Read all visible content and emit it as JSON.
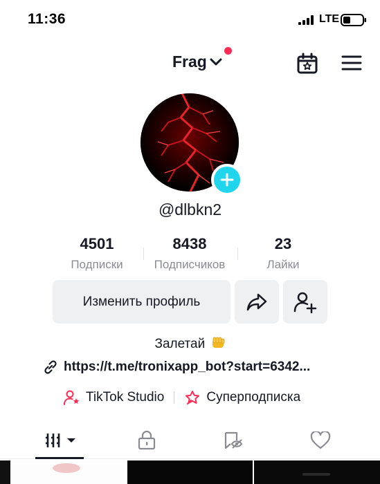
{
  "status_bar": {
    "time": "11:36",
    "network": "LTE",
    "icons": [
      "signal-icon",
      "battery-icon"
    ]
  },
  "header": {
    "account_name": "Frag",
    "icons": [
      "chevron-down-icon",
      "calendar-star-icon",
      "hamburger-menu-icon"
    ],
    "notification_dot_color": "#fe2c55"
  },
  "profile": {
    "username": "@dlbkn2",
    "avatar_accent": "#20d5ec",
    "stats": [
      {
        "value": "4501",
        "label": "Подписки"
      },
      {
        "value": "8438",
        "label": "Подписчиков"
      },
      {
        "value": "23",
        "label": "Лайки"
      }
    ],
    "edit_label": "Изменить профиль",
    "bio": "Залетай",
    "link": "https://t.me/tronixapp_bot?start=6342...",
    "studio_label": "TikTok Studio",
    "subscription_label": "Суперподписка"
  },
  "tabs": [
    "videos-grid-icon",
    "lock-icon",
    "repost-hidden-icon",
    "heart-icon"
  ],
  "colors": {
    "text": "#161823",
    "secondary": "#8a8b91",
    "button_bg": "#eff0f1",
    "brand_red": "#fe2c55"
  }
}
